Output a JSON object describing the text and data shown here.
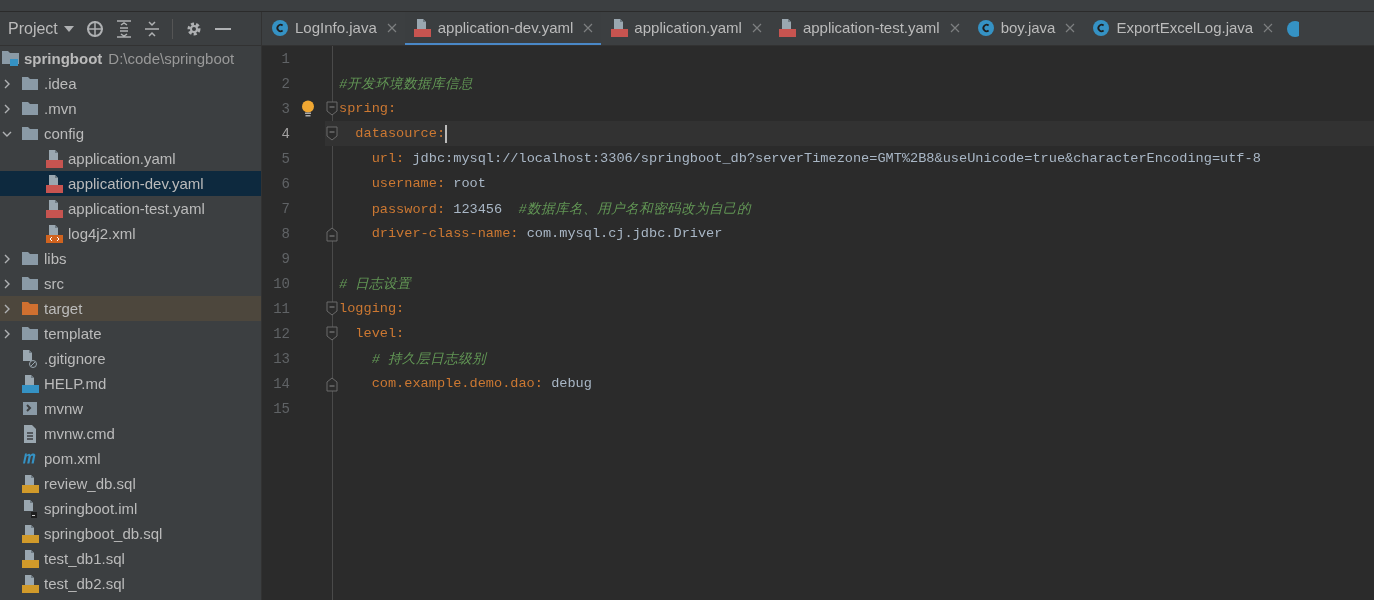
{
  "project_panel": {
    "title": "Project",
    "tree": [
      {
        "label": "springboot",
        "path": "D:\\code\\springboot",
        "kind": "module",
        "selected": false,
        "children": [
          {
            "label": ".idea",
            "kind": "folder",
            "expanded": false,
            "selected": false
          },
          {
            "label": ".mvn",
            "kind": "folder",
            "expanded": false,
            "selected": false
          },
          {
            "label": "config",
            "kind": "folder",
            "expanded": true,
            "selected": false,
            "children": [
              {
                "label": "application.yaml",
                "kind": "yaml",
                "selected": false
              },
              {
                "label": "application-dev.yaml",
                "kind": "yaml",
                "selected": true
              },
              {
                "label": "application-test.yaml",
                "kind": "yaml",
                "selected": false
              },
              {
                "label": "log4j2.xml",
                "kind": "xml",
                "selected": false
              }
            ]
          },
          {
            "label": "libs",
            "kind": "folder",
            "expanded": false,
            "selected": false
          },
          {
            "label": "src",
            "kind": "folder",
            "expanded": false,
            "selected": false
          },
          {
            "label": "target",
            "kind": "excluded-folder",
            "expanded": false,
            "selected": false
          },
          {
            "label": "template",
            "kind": "folder",
            "expanded": false,
            "selected": false
          },
          {
            "label": ".gitignore",
            "kind": "ignore",
            "selected": false
          },
          {
            "label": "HELP.md",
            "kind": "md",
            "selected": false
          },
          {
            "label": "mvnw",
            "kind": "script",
            "selected": false
          },
          {
            "label": "mvnw.cmd",
            "kind": "text",
            "selected": false
          },
          {
            "label": "pom.xml",
            "kind": "maven",
            "selected": false
          },
          {
            "label": "review_db.sql",
            "kind": "sql",
            "selected": false
          },
          {
            "label": "springboot.iml",
            "kind": "iml",
            "selected": false
          },
          {
            "label": "springboot_db.sql",
            "kind": "sql",
            "selected": false
          },
          {
            "label": "test_db1.sql",
            "kind": "sql",
            "selected": false
          },
          {
            "label": "test_db2.sql",
            "kind": "sql",
            "selected": false
          }
        ]
      }
    ]
  },
  "tabs": [
    {
      "label": "LogInfo.java",
      "kind": "java",
      "selected": false
    },
    {
      "label": "application-dev.yaml",
      "kind": "yaml",
      "selected": true
    },
    {
      "label": "application.yaml",
      "kind": "yaml",
      "selected": false
    },
    {
      "label": "application-test.yaml",
      "kind": "yaml",
      "selected": false
    },
    {
      "label": "boy.java",
      "kind": "java",
      "selected": false
    },
    {
      "label": "ExportExcelLog.java",
      "kind": "java",
      "selected": false
    }
  ],
  "editor": {
    "intention_bulb": true,
    "lines": [
      {
        "number": "1",
        "kind": "plain",
        "current": false
      },
      {
        "number": "2",
        "kind": "plain",
        "current": false,
        "segments": [
          {
            "kind": "comment",
            "text": "#开发环境数据库信息"
          }
        ]
      },
      {
        "number": "3",
        "kind": "fold-start",
        "current": false,
        "segments": [
          {
            "kind": "key",
            "text": "spring"
          },
          {
            "kind": "punct",
            "text": ":"
          }
        ]
      },
      {
        "number": "4",
        "kind": "fold-start",
        "current": true,
        "segments": [
          {
            "kind": "key",
            "text": "  datasource"
          },
          {
            "kind": "punct",
            "text": ":"
          }
        ]
      },
      {
        "number": "5",
        "kind": "plain",
        "current": false,
        "segments": [
          {
            "kind": "key",
            "text": "    url"
          },
          {
            "kind": "punct",
            "text": ": "
          },
          {
            "kind": "value",
            "text": "jdbc:mysql://localhost:3306/springboot_db?serverTimezone=GMT%2B8&useUnicode=true&characterEncoding=utf-8"
          }
        ]
      },
      {
        "number": "6",
        "kind": "plain",
        "current": false,
        "segments": [
          {
            "kind": "key",
            "text": "    username"
          },
          {
            "kind": "punct",
            "text": ": "
          },
          {
            "kind": "value",
            "text": "root"
          }
        ]
      },
      {
        "number": "7",
        "kind": "plain",
        "current": false,
        "segments": [
          {
            "kind": "key",
            "text": "    password"
          },
          {
            "kind": "punct",
            "text": ": "
          },
          {
            "kind": "value",
            "text": "123456  "
          },
          {
            "kind": "comment",
            "text": "#数据库名、用户名和密码改为自己的"
          }
        ]
      },
      {
        "number": "8",
        "kind": "fold-end",
        "current": false,
        "segments": [
          {
            "kind": "key",
            "text": "    driver-class-name"
          },
          {
            "kind": "punct",
            "text": ": "
          },
          {
            "kind": "value",
            "text": "com.mysql.cj.jdbc.Driver"
          }
        ]
      },
      {
        "number": "9",
        "kind": "plain",
        "current": false
      },
      {
        "number": "10",
        "kind": "plain",
        "current": false,
        "segments": [
          {
            "kind": "comment",
            "text": "# 日志设置"
          }
        ]
      },
      {
        "number": "11",
        "kind": "fold-start",
        "current": false,
        "segments": [
          {
            "kind": "key",
            "text": "logging"
          },
          {
            "kind": "punct",
            "text": ":"
          }
        ]
      },
      {
        "number": "12",
        "kind": "fold-start",
        "current": false,
        "segments": [
          {
            "kind": "key",
            "text": "  level"
          },
          {
            "kind": "punct",
            "text": ":"
          }
        ]
      },
      {
        "number": "13",
        "kind": "plain",
        "current": false,
        "segments": [
          {
            "kind": "comment",
            "text": "    # 持久层日志级别"
          }
        ]
      },
      {
        "number": "14",
        "kind": "fold-end",
        "current": false,
        "segments": [
          {
            "kind": "key",
            "text": "    com.example.demo.dao"
          },
          {
            "kind": "punct",
            "text": ": "
          },
          {
            "kind": "value",
            "text": "debug"
          }
        ]
      },
      {
        "number": "15",
        "kind": "plain",
        "current": false
      }
    ]
  }
}
